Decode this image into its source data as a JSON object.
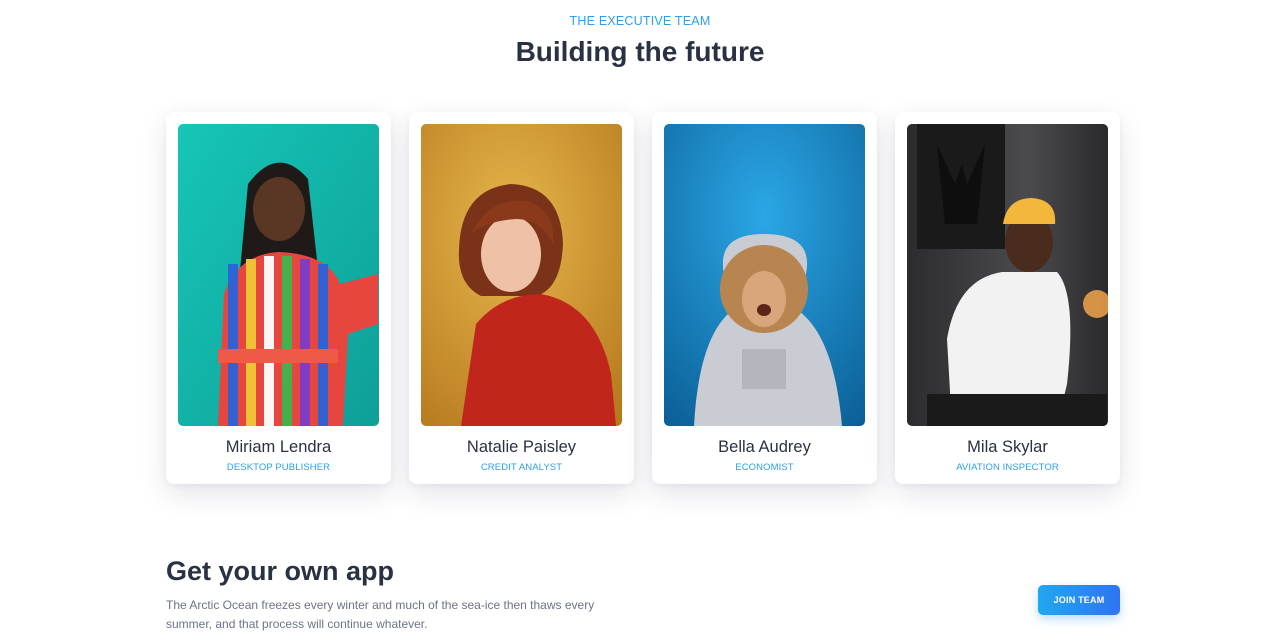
{
  "section": {
    "eyebrow": "THE EXECUTIVE TEAM",
    "title": "Building the future"
  },
  "team": [
    {
      "name": "Miriam Lendra",
      "role": "DESKTOP PUBLISHER",
      "photo_bg": "#12b9ad"
    },
    {
      "name": "Natalie Paisley",
      "role": "CREDIT ANALYST",
      "photo_bg": "#d69b32"
    },
    {
      "name": "Bella Audrey",
      "role": "ECONOMIST",
      "photo_bg": "#1a86c3"
    },
    {
      "name": "Mila Skylar",
      "role": "AVIATION INSPECTOR",
      "photo_bg": "#3b3b3d"
    }
  ],
  "cta": {
    "title": "Get your own app",
    "text": "The Arctic Ocean freezes every winter and much of the sea-ice then thaws every summer, and that process will continue whatever.",
    "button_label": "JOIN TEAM"
  },
  "colors": {
    "accent": "#2f9ee9",
    "heading": "#2a3142",
    "body_text": "#6b7385",
    "button_gradient_start": "#21a7f0",
    "button_gradient_end": "#2e74f2"
  }
}
